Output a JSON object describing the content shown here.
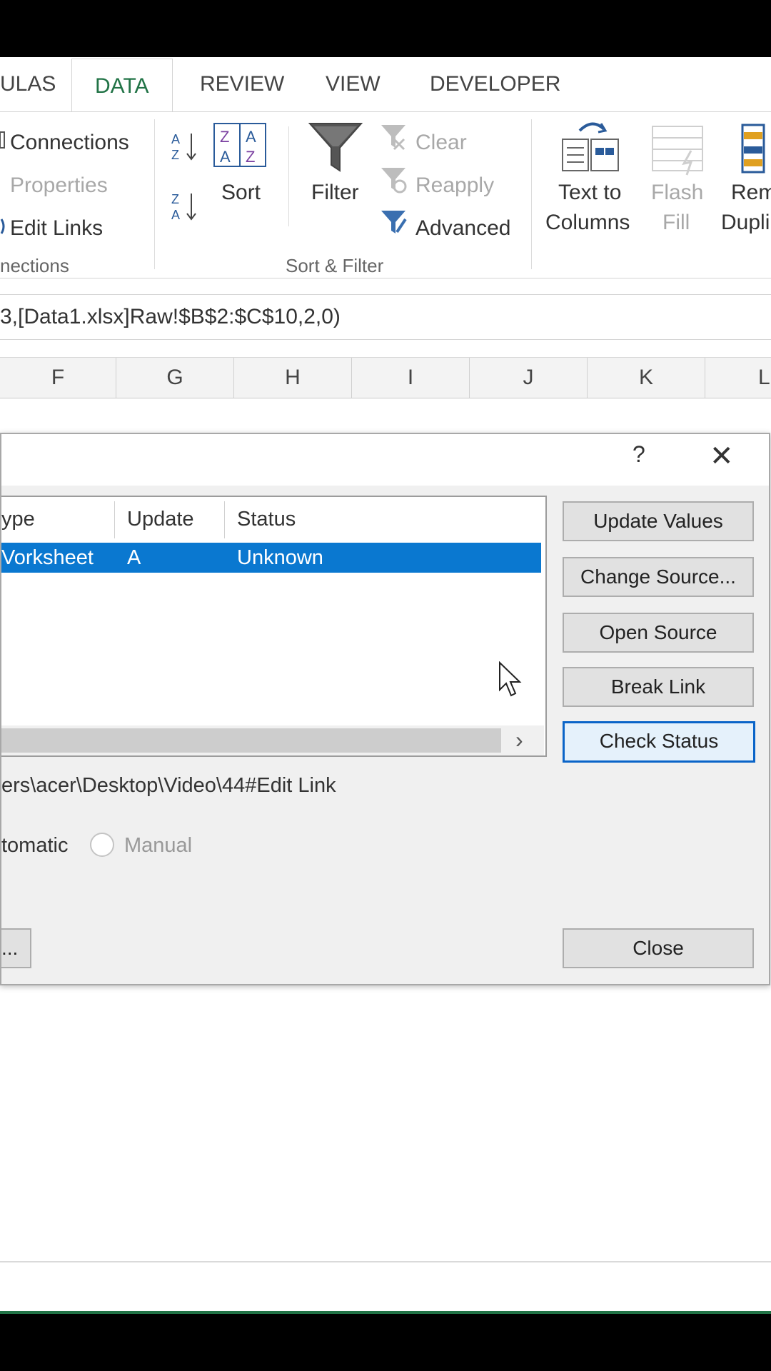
{
  "ribbon": {
    "tabs": [
      "ULAS",
      "DATA",
      "REVIEW",
      "VIEW",
      "DEVELOPER"
    ],
    "connections": {
      "connections_label": "Connections",
      "properties_label": "Properties",
      "edit_links_label": "Edit Links",
      "group_label": "nections"
    },
    "sort_filter": {
      "sort_label": "Sort",
      "filter_label": "Filter",
      "clear_label": "Clear",
      "reapply_label": "Reapply",
      "advanced_label": "Advanced",
      "group_label": "Sort & Filter"
    },
    "data_tools": {
      "text_to_columns_line1": "Text to",
      "text_to_columns_line2": "Columns",
      "flash_fill_line1": "Flash",
      "flash_fill_line2": "Fill",
      "remove_dup_line1": "Rem",
      "remove_dup_line2": "Dupli"
    }
  },
  "formula_bar": {
    "text": "3,[Data1.xlsx]Raw!$B$2:$C$10,2,0)"
  },
  "columns": [
    "F",
    "G",
    "H",
    "I",
    "J",
    "K",
    "L"
  ],
  "dialog": {
    "help": "?",
    "close_x": "✕",
    "list": {
      "headers": [
        "ype",
        "Update",
        "Status"
      ],
      "selected_row": {
        "type": "Vorksheet",
        "update": "A",
        "status": "Unknown"
      }
    },
    "buttons": {
      "update_values": "Update Values",
      "change_source": "Change Source...",
      "open_source": "Open Source",
      "break_link": "Break Link",
      "check_status": "Check Status",
      "close": "Close"
    },
    "source_path": "ers\\acer\\Desktop\\Video\\44#Edit Link",
    "update_automatic": "tomatic",
    "update_manual": "Manual",
    "startup_prompt": "..."
  },
  "colors": {
    "accent_green": "#217346",
    "selection_blue": "#0a78d0"
  }
}
